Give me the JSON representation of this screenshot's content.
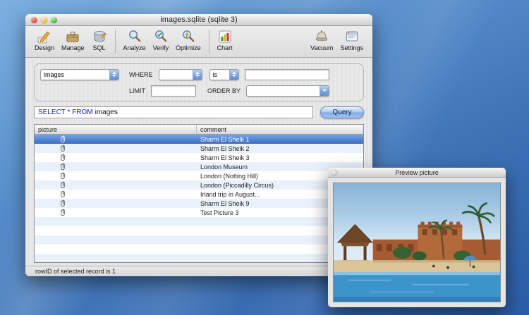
{
  "main_window": {
    "title": "images.sqlite (sqlite 3)",
    "toolbar": {
      "items": [
        {
          "label": "Design"
        },
        {
          "label": "Manage"
        },
        {
          "label": "SQL"
        },
        {
          "label": "Analyze"
        },
        {
          "label": "Verify"
        },
        {
          "label": "Optimize"
        },
        {
          "label": "Chart"
        },
        {
          "label": "Vacuum"
        },
        {
          "label": "Settings"
        }
      ]
    },
    "query_builder": {
      "table_value": "images",
      "where_label": "WHERE",
      "where_field_value": "",
      "operator_value": "is",
      "where_text_value": "",
      "limit_label": "LIMIT",
      "limit_value": "",
      "order_by_label": "ORDER BY",
      "order_by_value": "",
      "sql_keywords": "SELECT * FROM",
      "sql_object": "images",
      "query_button_label": "Query"
    },
    "table": {
      "columns": [
        "picture",
        "comment"
      ],
      "rows": [
        {
          "has_attachment": true,
          "comment": "Sharm El Sheik 1",
          "selected": true
        },
        {
          "has_attachment": true,
          "comment": "Sharm El Sheik 2",
          "selected": false
        },
        {
          "has_attachment": true,
          "comment": "Sharm El Sheik 3",
          "selected": false
        },
        {
          "has_attachment": true,
          "comment": "London Museum",
          "selected": false
        },
        {
          "has_attachment": true,
          "comment": "London (Notting Hill)",
          "selected": false
        },
        {
          "has_attachment": true,
          "comment": "London (Piccadilly Circus)",
          "selected": false
        },
        {
          "has_attachment": true,
          "comment": "Irland trip in August...",
          "selected": false
        },
        {
          "has_attachment": true,
          "comment": "Sharm El Sheik 9",
          "selected": false
        },
        {
          "has_attachment": true,
          "comment": "Test Picture 3",
          "selected": false
        }
      ]
    },
    "status": "rowID of selected record is 1"
  },
  "preview_window": {
    "title": "Preview picture"
  },
  "colors": {
    "selection": "#3b69c8",
    "sql_keyword": "#1414e6",
    "desktop_top": "#7db0e0",
    "desktop_bottom": "#2b5ca6"
  }
}
